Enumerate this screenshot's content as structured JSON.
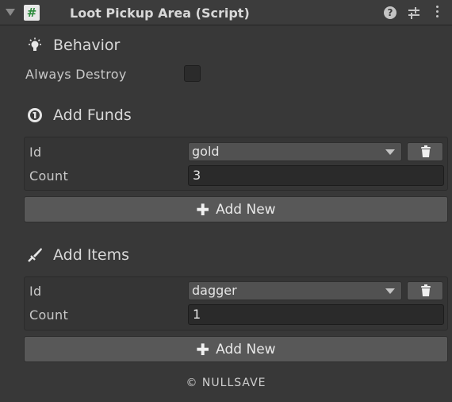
{
  "header": {
    "title": "Loot Pickup Area (Script)",
    "script_glyph": "#",
    "help_glyph": "?"
  },
  "behavior": {
    "title": "Behavior",
    "icon": "lightbulb-icon",
    "always_destroy_label": "Always Destroy",
    "always_destroy_checked": false
  },
  "funds": {
    "title": "Add Funds",
    "icon": "coin-icon",
    "id_label": "Id",
    "id_value": "gold",
    "count_label": "Count",
    "count_value": "3",
    "add_label": "Add New",
    "plus_glyph": "✚"
  },
  "items": {
    "title": "Add Items",
    "icon": "sword-icon",
    "id_label": "Id",
    "id_value": "dagger",
    "count_label": "Count",
    "count_value": "1",
    "add_label": "Add New",
    "plus_glyph": "✚"
  },
  "footer": {
    "text": "© NULLSAVE"
  }
}
